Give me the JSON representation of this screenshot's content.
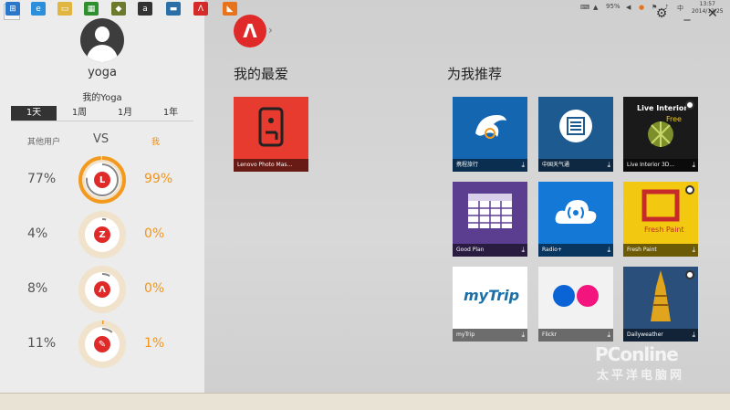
{
  "corner_label": "中",
  "user": {
    "name": "yoga",
    "subtitle": "我的Yoga"
  },
  "periods": [
    "1天",
    "1周",
    "1月",
    "1年"
  ],
  "active_period": "1天",
  "compare": {
    "others_label": "其他用户",
    "vs_label": "VS",
    "me_label": "我"
  },
  "stats": [
    {
      "others": "77%",
      "me": "99%",
      "others_value": 0.77,
      "me_value": 0.99,
      "icon": "lenovo-L-icon",
      "glyph": "L"
    },
    {
      "others": "4%",
      "me": "0%",
      "others_value": 0.04,
      "me_value": 0.0,
      "icon": "lenovo-Z-icon",
      "glyph": "Z"
    },
    {
      "others": "8%",
      "me": "0%",
      "others_value": 0.08,
      "me_value": 0.0,
      "icon": "lenovo-A-icon",
      "glyph": "Λ"
    },
    {
      "others": "11%",
      "me": "1%",
      "others_value": 0.11,
      "me_value": 0.01,
      "icon": "lenovo-pen-icon",
      "glyph": "✎"
    }
  ],
  "app": {
    "logo_glyph": "Λ",
    "chevron": "›",
    "settings_glyph": "⚙",
    "minimize_glyph": "_",
    "close_glyph": "✕"
  },
  "favorites": {
    "title": "我的最爱",
    "tiles": [
      {
        "caption": "Lenovo Photo Mas...",
        "color": "#e63b2e",
        "icon": "photo-master-face-icon"
      }
    ]
  },
  "recommended": {
    "title": "为我推荐",
    "tiles": [
      {
        "caption": "携程旅行",
        "color": "#1566b0",
        "icon": "ctrip-dolphin-icon"
      },
      {
        "caption": "中国天气通",
        "color": "#1d5a8f",
        "icon": "weather-seal-icon"
      },
      {
        "caption": "Live Interior 3D...",
        "color": "#1a1a1a",
        "icon": "live-interior-icon",
        "art_text": "Live Interior 3D",
        "art_sub": "Free"
      },
      {
        "caption": "Good Plan",
        "color": "#5b3e8f",
        "icon": "calendar-icon"
      },
      {
        "caption": "Radio+",
        "color": "#1478d6",
        "icon": "radio-cloud-icon"
      },
      {
        "caption": "Fresh Paint",
        "color": "#f2c811",
        "icon": "fresh-paint-frame-icon",
        "art_text": "Fresh Paint"
      },
      {
        "caption": "myTrip",
        "color": "#ffffff",
        "icon": "mytrip-icon",
        "art_text": "myTrip"
      },
      {
        "caption": "Flickr",
        "color": "#f2f2f2",
        "icon": "flickr-dots-icon"
      },
      {
        "caption": "Dailyweather",
        "color": "#2a4f7a",
        "icon": "weather-tower-icon"
      }
    ]
  },
  "watermark": {
    "line1": "PConline",
    "line2": "太平洋电脑网"
  },
  "taskbar": {
    "apps": [
      {
        "icon": "windows-start-icon",
        "color": "#2b77c9",
        "glyph": "⊞"
      },
      {
        "icon": "internet-explorer-icon",
        "color": "#2b8fdc",
        "glyph": "e"
      },
      {
        "icon": "file-explorer-icon",
        "color": "#e0b640",
        "glyph": "▭"
      },
      {
        "icon": "store-app-icon",
        "color": "#2f8f2f",
        "glyph": "▦"
      },
      {
        "icon": "package-app-icon",
        "color": "#6c7a2d",
        "glyph": "◆"
      },
      {
        "icon": "amazon-icon",
        "color": "#333333",
        "glyph": "a"
      },
      {
        "icon": "monitor-app-icon",
        "color": "#2a6fa8",
        "glyph": "▬"
      },
      {
        "icon": "lenovo-app-icon",
        "color": "#d52a2a",
        "glyph": "Λ"
      },
      {
        "icon": "orange-app-icon",
        "color": "#e8731c",
        "glyph": "◣"
      }
    ],
    "battery": "95%",
    "time": "13:57",
    "date": "2014/12/25"
  }
}
